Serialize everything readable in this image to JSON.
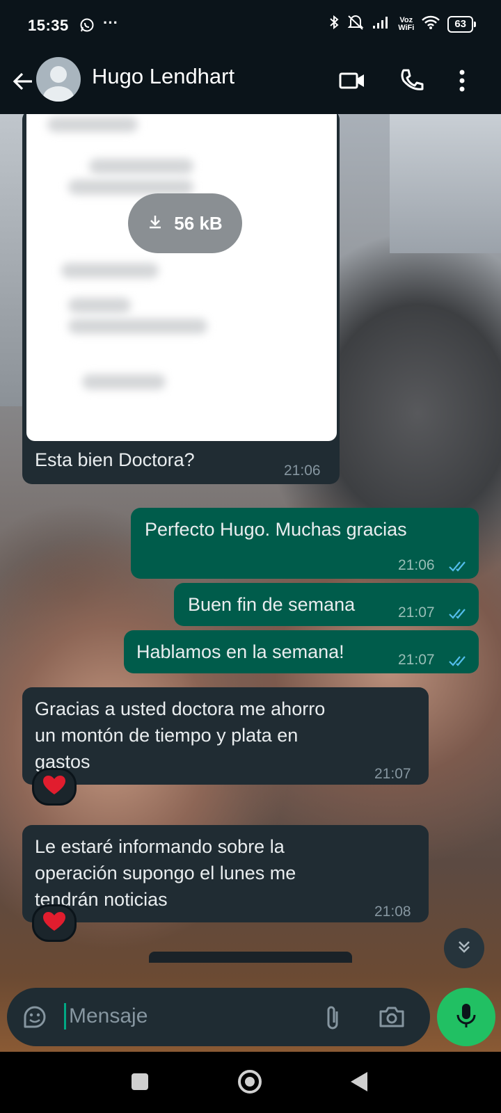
{
  "status_bar": {
    "time": "15:35",
    "more": "···",
    "voz_line1": "Voz",
    "voz_line2": "WiFi",
    "battery": "63",
    "icons": [
      "whatsapp-icon",
      "bluetooth-icon",
      "mute-icon",
      "signal-icon",
      "wifi-icon",
      "battery-icon"
    ]
  },
  "header": {
    "contact_name": "Hugo Lendhart",
    "icons": [
      "back-arrow-icon",
      "avatar-icon",
      "video-call-icon",
      "phone-icon",
      "more-vert-icon"
    ]
  },
  "messages": [
    {
      "type": "document",
      "direction": "incoming",
      "file_size": "56 kB",
      "caption": "Esta bien Doctora?",
      "time": "21:06"
    },
    {
      "type": "text",
      "direction": "outgoing",
      "text": "Perfecto Hugo. Muchas gracias",
      "time": "21:06",
      "status": "read"
    },
    {
      "type": "text",
      "direction": "outgoing",
      "text": "Buen fin de semana",
      "time": "21:07",
      "status": "read"
    },
    {
      "type": "text",
      "direction": "outgoing",
      "text": "Hablamos en la semana!",
      "time": "21:07",
      "status": "read"
    },
    {
      "type": "text",
      "direction": "incoming",
      "text": [
        "Gracias a usted doctora me ahorro",
        "un montón de tiempo y plata en",
        "gastos"
      ],
      "time": "21:07",
      "reaction": "heart"
    },
    {
      "type": "text",
      "direction": "incoming",
      "text": [
        "Le estaré informando sobre la",
        "operación supongo el lunes me",
        "tendrán noticias"
      ],
      "time": "21:08",
      "reaction": "heart"
    }
  ],
  "composer": {
    "placeholder": "Mensaje",
    "icons": [
      "sticker-icon",
      "attach-icon",
      "camera-icon",
      "mic-icon"
    ]
  },
  "colors": {
    "header_bg": "#0b141a",
    "incoming_bubble": "#202c33",
    "outgoing_bubble": "#005c4b",
    "read_ticks": "#53bdeb",
    "mic_button": "#21c063"
  }
}
